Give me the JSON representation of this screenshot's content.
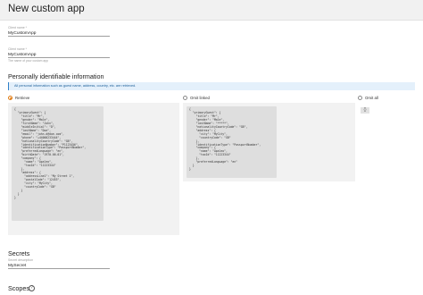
{
  "window": {
    "title": "New custom app"
  },
  "client_name": {
    "label": "Client name *",
    "value": "MyCustomApp"
  },
  "client_id": {
    "label": "Client name *",
    "value": "MyCustomApp",
    "help": "The name of your custom app"
  },
  "pii": {
    "title": "Personally identifiable information",
    "info": "All personal information such as guest name, address, country, etc. are retrieved.",
    "options": [
      {
        "label": "Retrieve",
        "selected": true
      },
      {
        "label": "Omit linked",
        "selected": false
      },
      {
        "label": "Omit all",
        "selected": false
      }
    ],
    "retrieve_code": "{\n  \"primaryGuest\": {\n    \"title\": \"Mr\",\n    \"gender\": \"Male\",\n    \"firstName\": \"John\",\n    \"middleInitial\": \"D\",\n    \"lastName\": \"Doe\",\n    \"email\": \"john.d@doe.com\",\n    \"phone\": \"+44000233444\",\n    \"nationalityCountryCode\": \"GB\",\n    \"identificationNumber\": \"P1123456\",\n    \"identificationType\": \"PassportNumber\",\n    \"preferredLanguage\": \"en\",\n    \"birthDate\": \"1970-06-01\",\n    \"company\": {\n      \"name\": \"Apaleo\",\n      \"taxId\": \"11223344\"\n    },\n    \"address\": {\n      \"addressLine1\": \"My Street 1\",\n      \"postalCode\": \"12453\",\n      \"city\": \"MyCity\",\n      \"countryCode\": \"GB\"\n    }\n  }\n}",
    "omit_linked_code": "{\n  \"primaryGuest\": {\n    \"title\": \"Mr\",\n    \"gender\": \"Male\",\n    \"lastName\": \"*****\",\n    \"nationalityCountryCode\": \"GB\",\n    \"address\": {\n      \"city\": \"MyCity\",\n      \"countryCode\": \"GB\"\n    },\n    \"identificationType\": \"PassportNumber\",\n    \"company\": {\n      \"name\": \"Apaleo\",\n      \"taxId\": \"11223344\"\n    },\n    \"preferredLanguage\": \"en\"\n  }\n}",
    "omit_all_code": "{}"
  },
  "secrets": {
    "title": "Secrets",
    "label": "Secret description",
    "value": "MySecret"
  },
  "scopes": {
    "title": "Scopes",
    "icon": "help-icon"
  },
  "colors": {
    "accent": "#e07a11",
    "info_bg": "#e4f0fb",
    "info_border": "#2f80c9"
  }
}
